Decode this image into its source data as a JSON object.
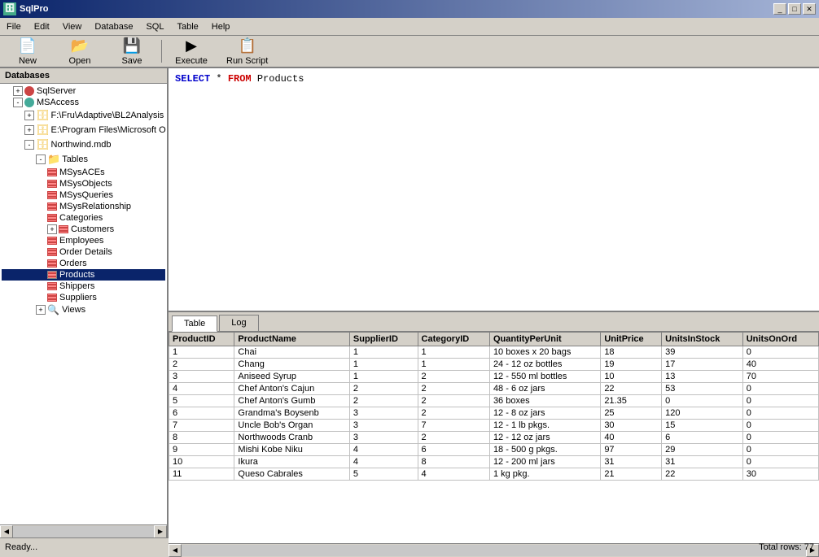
{
  "app": {
    "title": "SqlPro",
    "icon": "🗄"
  },
  "titlebar": {
    "controls": [
      "_",
      "□",
      "✕"
    ]
  },
  "menubar": {
    "items": [
      "File",
      "Edit",
      "View",
      "Database",
      "SQL",
      "Table",
      "Help"
    ]
  },
  "toolbar": {
    "buttons": [
      {
        "id": "new",
        "label": "New",
        "icon": "📄"
      },
      {
        "id": "open",
        "label": "Open",
        "icon": "📂"
      },
      {
        "id": "save",
        "label": "Save",
        "icon": "💾"
      },
      {
        "id": "execute",
        "label": "Execute",
        "icon": "▶"
      },
      {
        "id": "run-script",
        "label": "Run Script",
        "icon": "📋"
      }
    ]
  },
  "sidebar": {
    "header": "Databases",
    "tree": {
      "servers": [
        {
          "name": "SqlServer",
          "type": "server",
          "color": "red",
          "expanded": false
        },
        {
          "name": "MSAccess",
          "type": "server",
          "color": "green",
          "expanded": true,
          "children": [
            {
              "name": "F:\\Fru\\Adaptive\\BL2Analysis",
              "type": "db",
              "expanded": false
            },
            {
              "name": "E:\\Program Files\\Microsoft O",
              "type": "db",
              "expanded": false
            },
            {
              "name": "Northwind.mdb",
              "type": "db",
              "expanded": true,
              "children": [
                {
                  "name": "Tables",
                  "type": "folder",
                  "expanded": true,
                  "children": [
                    "MSysACEs",
                    "MSysObjects",
                    "MSysQueries",
                    "MSysRelationship",
                    "Categories",
                    "Customers",
                    "Employees",
                    "Order Details",
                    "Orders",
                    "Products",
                    "Shippers",
                    "Suppliers"
                  ]
                },
                {
                  "name": "Views",
                  "type": "views",
                  "expanded": false
                }
              ]
            }
          ]
        }
      ]
    }
  },
  "editor": {
    "sql": "SELECT * FROM Products"
  },
  "tabs": [
    {
      "id": "table",
      "label": "Table",
      "active": true
    },
    {
      "id": "log",
      "label": "Log",
      "active": false
    }
  ],
  "results": {
    "columns": [
      "ProductID",
      "ProductName",
      "SupplierID",
      "CategoryID",
      "QuantityPerUnit",
      "UnitPrice",
      "UnitsInStock",
      "UnitsOnOrd"
    ],
    "rows": [
      [
        1,
        "Chai",
        1,
        1,
        "10 boxes x 20 bags",
        18,
        39,
        0
      ],
      [
        2,
        "Chang",
        1,
        1,
        "24 - 12 oz bottles",
        19,
        17,
        40
      ],
      [
        3,
        "Aniseed Syrup",
        1,
        2,
        "12 - 550 ml bottles",
        10,
        13,
        70
      ],
      [
        4,
        "Chef Anton's Cajun",
        2,
        2,
        "48 - 6 oz jars",
        22,
        53,
        0
      ],
      [
        5,
        "Chef Anton's Gumb",
        2,
        2,
        "36 boxes",
        21.35,
        0,
        0
      ],
      [
        6,
        "Grandma's Boysenb",
        3,
        2,
        "12 - 8 oz jars",
        25,
        120,
        0
      ],
      [
        7,
        "Uncle Bob's Organ",
        3,
        7,
        "12 - 1 lb pkgs.",
        30,
        15,
        0
      ],
      [
        8,
        "Northwoods Cranb",
        3,
        2,
        "12 - 12 oz jars",
        40,
        6,
        0
      ],
      [
        9,
        "Mishi Kobe Niku",
        4,
        6,
        "18 - 500 g pkgs.",
        97,
        29,
        0
      ],
      [
        10,
        "Ikura",
        4,
        8,
        "12 - 200 ml jars",
        31,
        31,
        0
      ],
      [
        11,
        "Queso Cabrales",
        5,
        4,
        "1 kg pkg.",
        21,
        22,
        30
      ]
    ]
  },
  "statusbar": {
    "left": "Ready...",
    "right": "Total rows: 77"
  }
}
